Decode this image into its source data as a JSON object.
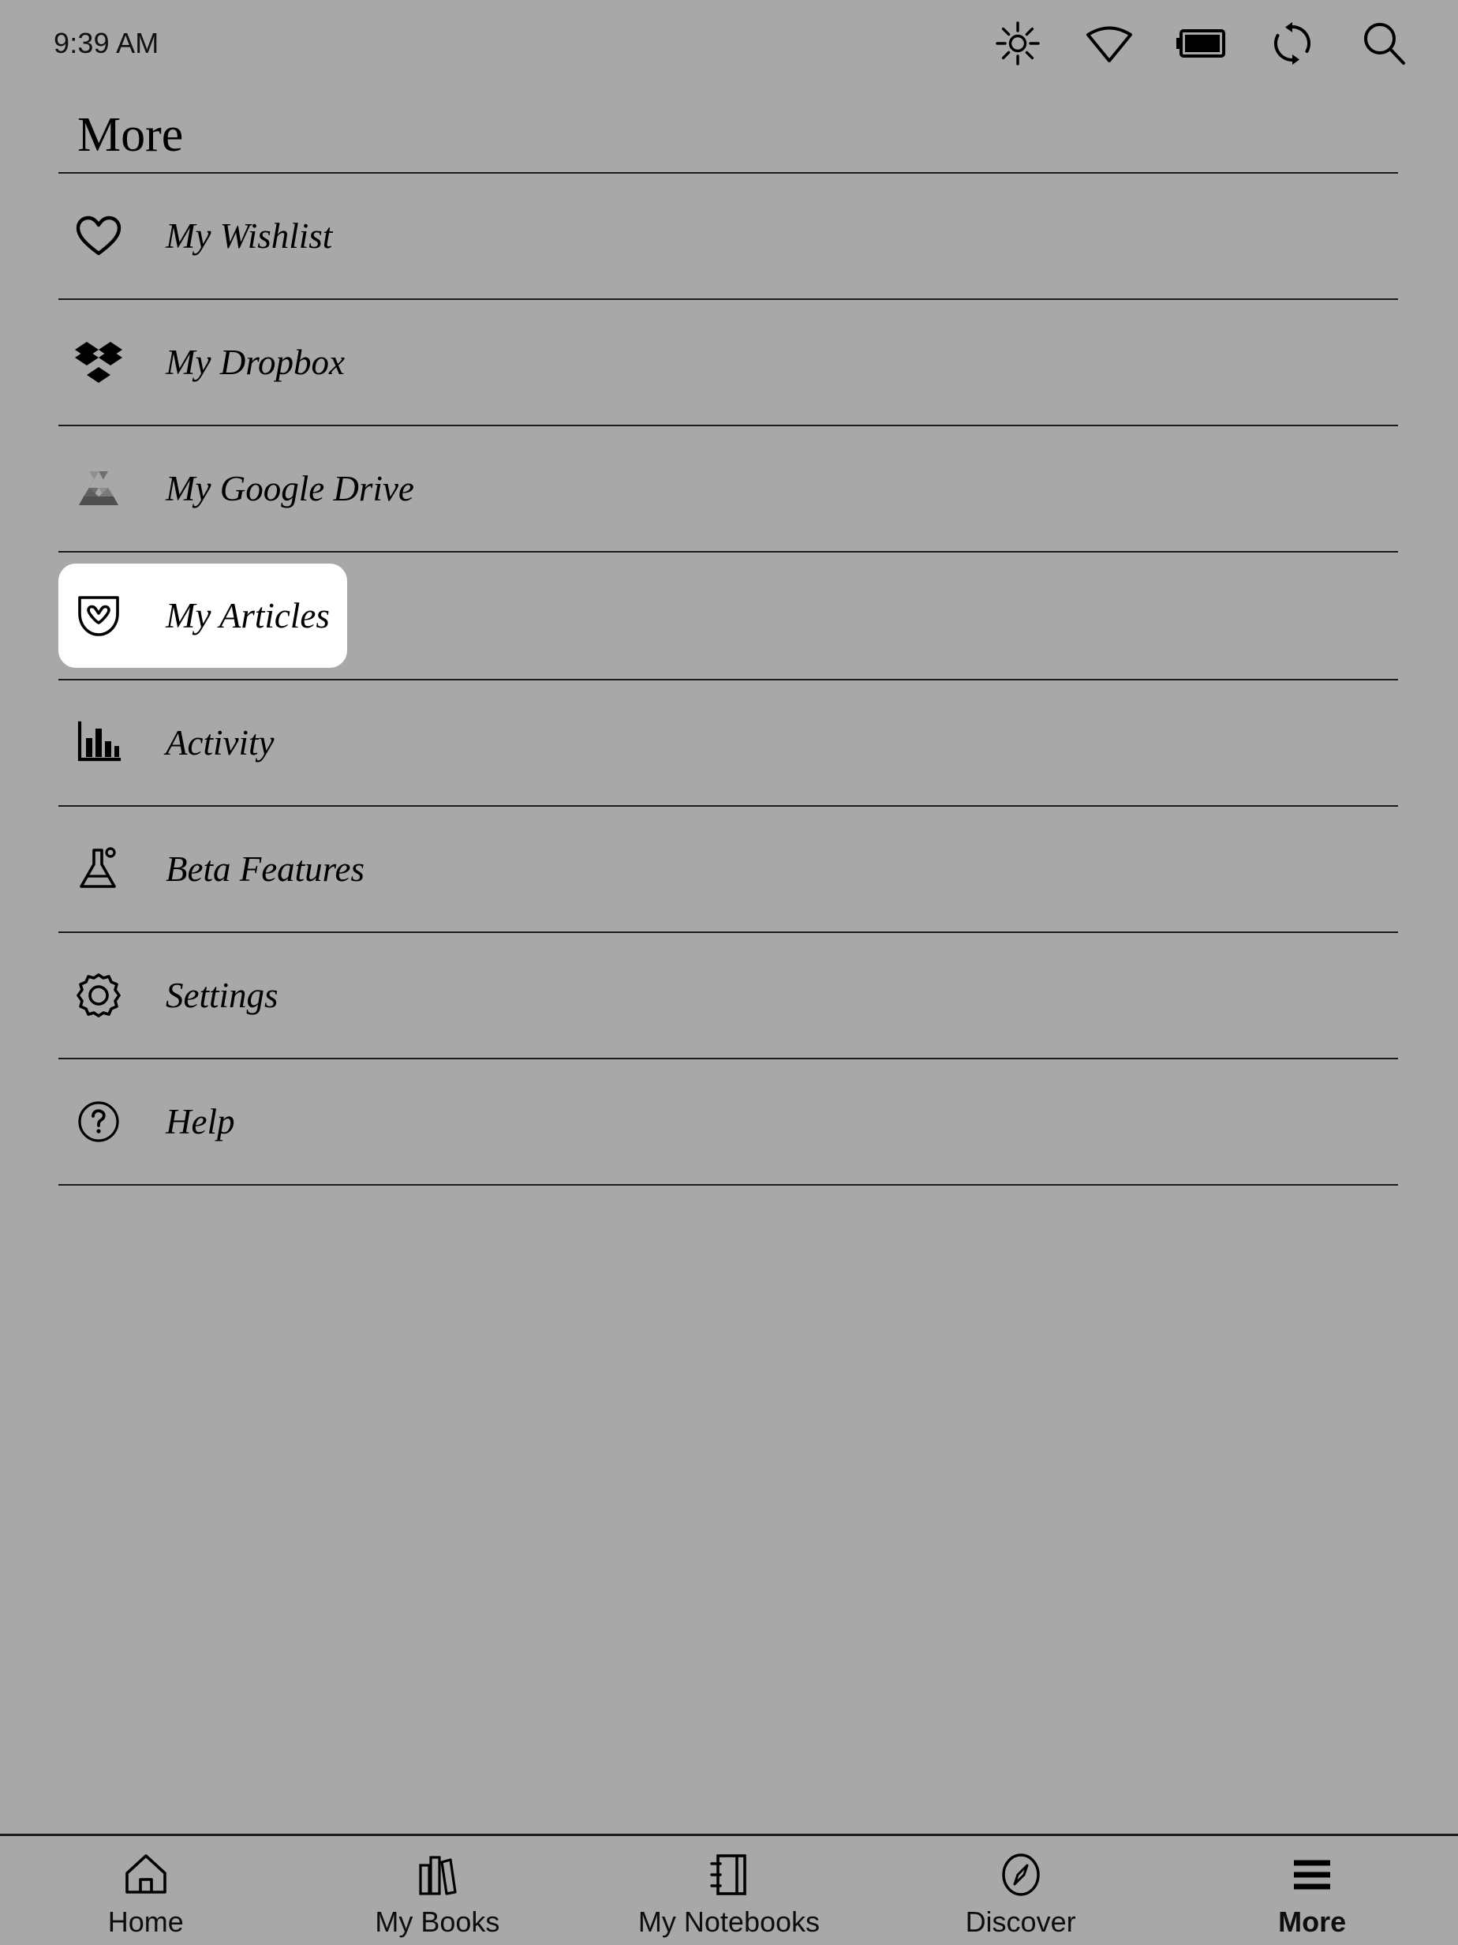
{
  "theme": {
    "background": "#a8a8a8",
    "ink": "#000000",
    "selected_background": "#ffffff",
    "divider": "#1b1b1b"
  },
  "status_bar": {
    "time": "9:39 AM",
    "icons": [
      {
        "name": "brightness-icon",
        "label": "Brightness"
      },
      {
        "name": "wifi-icon",
        "label": "Wi-Fi"
      },
      {
        "name": "battery-icon",
        "label": "Battery"
      },
      {
        "name": "sync-icon",
        "label": "Sync"
      },
      {
        "name": "search-icon",
        "label": "Search"
      }
    ]
  },
  "header": {
    "title": "More"
  },
  "menu": {
    "items": [
      {
        "label": "My Wishlist",
        "icon": "heart-icon",
        "selected": false
      },
      {
        "label": "My Dropbox",
        "icon": "dropbox-icon",
        "selected": false
      },
      {
        "label": "My Google Drive",
        "icon": "google-drive-icon",
        "selected": false
      },
      {
        "label": "My Articles",
        "icon": "pocket-icon",
        "selected": true
      },
      {
        "label": "Activity",
        "icon": "bar-chart-icon",
        "selected": false
      },
      {
        "label": "Beta Features",
        "icon": "flask-icon",
        "selected": false
      },
      {
        "label": "Settings",
        "icon": "gear-icon",
        "selected": false
      },
      {
        "label": "Help",
        "icon": "question-circle-icon",
        "selected": false
      }
    ]
  },
  "bottom_nav": {
    "items": [
      {
        "label": "Home",
        "icon": "home-icon",
        "active": false
      },
      {
        "label": "My Books",
        "icon": "books-icon",
        "active": false
      },
      {
        "label": "My Notebooks",
        "icon": "notebook-icon",
        "active": false
      },
      {
        "label": "Discover",
        "icon": "compass-icon",
        "active": false
      },
      {
        "label": "More",
        "icon": "hamburger-icon",
        "active": true
      }
    ]
  }
}
